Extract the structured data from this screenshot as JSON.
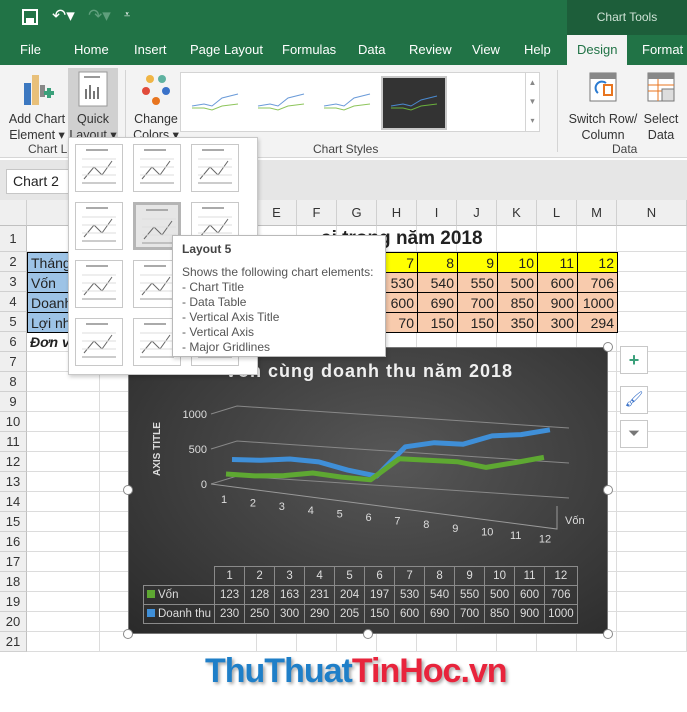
{
  "window": {
    "context_title": "Chart Tools"
  },
  "tabs": [
    "File",
    "Home",
    "Insert",
    "Page Layout",
    "Formulas",
    "Data",
    "Review",
    "View",
    "Help",
    "Design",
    "Format"
  ],
  "active_tab": "Design",
  "ribbon": {
    "add_chart_element": [
      "Add Chart",
      "Element"
    ],
    "quick_layout": [
      "Quick",
      "Layout"
    ],
    "change_colors": [
      "Change",
      "Colors"
    ],
    "switch_row_col": [
      "Switch Row/",
      "Column"
    ],
    "select_data": [
      "Select",
      "Data"
    ],
    "groups": {
      "chart_layouts": "Chart La",
      "chart_styles": "Chart Styles",
      "data": "Data"
    }
  },
  "name_box": "Chart 2",
  "columns": [
    "E",
    "F",
    "G",
    "H",
    "I",
    "J",
    "K",
    "L",
    "M",
    "N"
  ],
  "rows": [
    "1",
    "2",
    "3",
    "4",
    "5",
    "6",
    "7",
    "8",
    "9",
    "10",
    "11",
    "12",
    "13",
    "14",
    "15",
    "16",
    "17",
    "18",
    "19",
    "20",
    "21"
  ],
  "sheet": {
    "title_fragment": "ại trong năm 2018",
    "row_labels": [
      "Tháng",
      "Vốn",
      "Doanh",
      "Lợi nh",
      "Đơn vị"
    ],
    "months": [
      "7",
      "8",
      "9",
      "10",
      "11",
      "12"
    ],
    "von": [
      "530",
      "540",
      "550",
      "500",
      "600",
      "706"
    ],
    "doanh_thu": [
      "600",
      "690",
      "700",
      "850",
      "900",
      "1000"
    ],
    "loi_nhuan": [
      "70",
      "150",
      "150",
      "350",
      "300",
      "294"
    ]
  },
  "tooltip": {
    "title": "Layout 5",
    "intro": "Shows the following chart elements:",
    "items": [
      "- Chart Title",
      "- Data Table",
      "- Vertical Axis Title",
      "- Vertical Axis",
      "- Major Gridlines"
    ]
  },
  "chart_data": {
    "type": "line",
    "title": "Vốn cùng doanh thu năm 2018",
    "ylabel": "AXIS TITLE",
    "yticks": [
      "0",
      "500",
      "1000"
    ],
    "ylim": [
      0,
      1000
    ],
    "depth_label": "Vốn",
    "categories": [
      "1",
      "2",
      "3",
      "4",
      "5",
      "6",
      "7",
      "8",
      "9",
      "10",
      "11",
      "12"
    ],
    "series": [
      {
        "name": "Vốn",
        "color": "#5ea832",
        "values": [
          123,
          128,
          163,
          231,
          204,
          197,
          530,
          540,
          550,
          500,
          600,
          706
        ]
      },
      {
        "name": "Doanh thu",
        "color": "#3f8fd8",
        "values": [
          230,
          250,
          300,
          290,
          205,
          150,
          600,
          690,
          700,
          850,
          900,
          1000
        ]
      }
    ],
    "data_table": true,
    "grid": true
  },
  "logo": {
    "part1": "ThuThuat",
    "part2": "TinHoc.vn"
  }
}
